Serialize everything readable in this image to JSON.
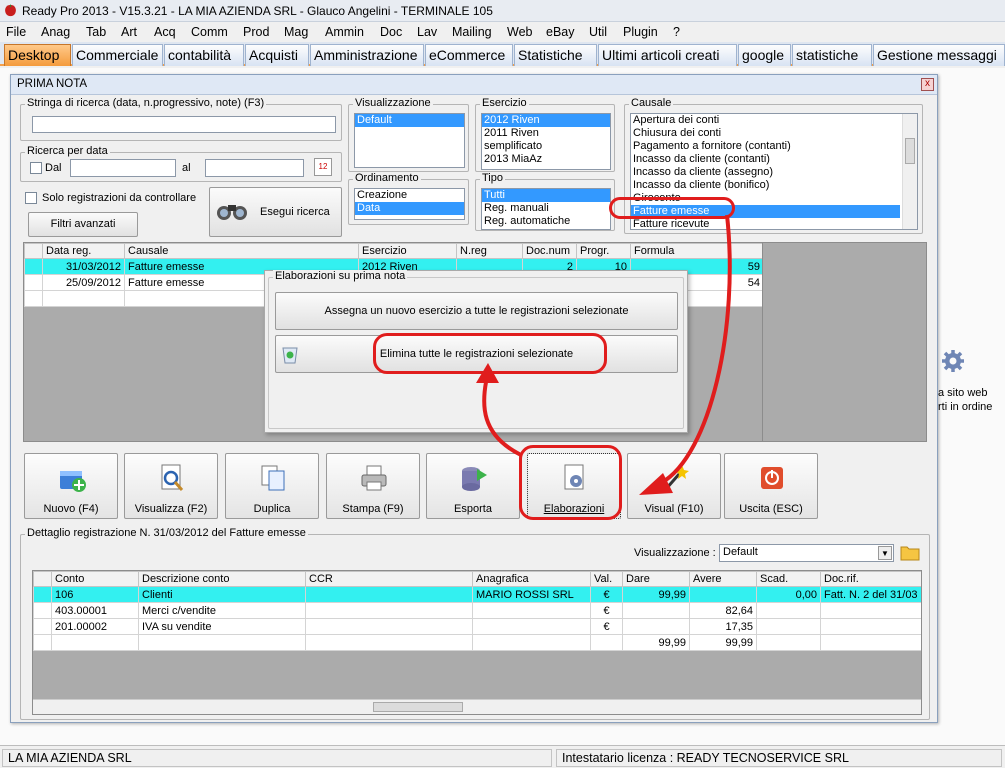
{
  "app": {
    "title": "Ready Pro 2013 - V15.3.21 - LA MIA AZIENDA SRL - Glauco Angelini - TERMINALE 105"
  },
  "menu": [
    "File",
    "Anag",
    "Tab",
    "Art",
    "Acq",
    "Comm",
    "Prod",
    "Mag",
    "Ammin",
    "Doc",
    "Lav",
    "Mailing",
    "Web",
    "eBay",
    "Util",
    "Plugin",
    "?"
  ],
  "tabs": [
    "Desktop",
    "Commerciale",
    "contabilità",
    "Acquisti",
    "Amministrazione",
    "eCommerce",
    "Statistiche",
    "Ultimi articoli creati",
    "google",
    "statistiche",
    "Gestione messaggi"
  ],
  "desktop_shortcut": {
    "line1": "a sito web",
    "line2": "rti in ordine"
  },
  "window": {
    "title": "PRIMA NOTA",
    "close": "x"
  },
  "search": {
    "label": "Stringa di ricerca (data, n.progressivo, note) (F3)",
    "value": ""
  },
  "date_search": {
    "label": "Ricerca per data",
    "dal_label": "Dal",
    "al_label": "al",
    "dal_value": "",
    "al_value": "",
    "cal_icon": "12"
  },
  "only_control": "Solo registrazioni da controllare",
  "filter_button": "Filtri avanzati",
  "search_button": "Esegui ricerca",
  "visualizzazione": {
    "label": "Visualizzazione",
    "items": [
      "Default"
    ],
    "selected": "Default"
  },
  "ordinamento": {
    "label": "Ordinamento",
    "items": [
      "Creazione",
      "Data"
    ],
    "selected": "Data"
  },
  "esercizio": {
    "label": "Esercizio",
    "items": [
      "2012 Riven",
      "2011 Riven",
      "semplificato",
      "2013 MiaAz"
    ],
    "selected": "2012 Riven"
  },
  "tipo": {
    "label": "Tipo",
    "items": [
      "Tutti",
      "Reg. manuali",
      "Reg. automatiche"
    ],
    "selected": "Tutti"
  },
  "causale": {
    "label": "Causale",
    "items": [
      "Apertura dei conti",
      "Chiusura dei conti",
      "Pagamento a fornitore (contanti)",
      "Incasso da cliente (contanti)",
      "Incasso da cliente (assegno)",
      "Incasso da cliente (bonifico)",
      "Giroconto",
      "Fatture emesse",
      "Fatture ricevute"
    ],
    "selected": "Fatture emesse"
  },
  "reg_grid": {
    "columns": [
      "Data reg.",
      "Causale",
      "Esercizio",
      "N.reg",
      "Doc.num",
      "Progr.",
      "Formula"
    ],
    "rows": [
      {
        "date": "31/03/2012",
        "causale": "Fatture emesse",
        "esercizio": "2012 Riven",
        "nreg": "",
        "docnum": "2",
        "progr": "10",
        "formula": "59"
      },
      {
        "date": "25/09/2012",
        "causale": "Fatture emesse",
        "esercizio": "",
        "nreg": "",
        "docnum": "",
        "progr": "",
        "formula": "54"
      }
    ]
  },
  "popup": {
    "title": "Elaborazioni su prima nota",
    "btn1": "Assegna un nuovo esercizio a tutte le registrazioni selezionate",
    "btn2": "Elimina tutte le registrazioni selezionate"
  },
  "toolbar": [
    "Nuovo (F4)",
    "Visualizza (F2)",
    "Duplica",
    "Stampa (F9)",
    "Esporta",
    "Elaborazioni",
    "Visual (F10)",
    "Uscita (ESC)"
  ],
  "detail": {
    "label": "Dettaglio registrazione N. 31/03/2012 del Fatture emesse",
    "view_label": "Visualizzazione :",
    "view_value": "Default"
  },
  "detail_grid": {
    "columns": [
      "Conto",
      "Descrizione conto",
      "CCR",
      "Anagrafica",
      "Val.",
      "Dare",
      "Avere",
      "Scad.",
      "Doc.rif."
    ],
    "rows": [
      {
        "conto": "106",
        "desc": "Clienti",
        "ccr": "",
        "anag": "MARIO ROSSI SRL",
        "val": "€",
        "dare": "99,99",
        "avere": "",
        "scad": "0,00",
        "docrif": "Fatt. N. 2 del 31/03"
      },
      {
        "conto": "403.00001",
        "desc": "Merci c/vendite",
        "ccr": "",
        "anag": "",
        "val": "€",
        "dare": "",
        "avere": "82,64",
        "scad": "",
        "docrif": ""
      },
      {
        "conto": "201.00002",
        "desc": "IVA su vendite",
        "ccr": "",
        "anag": "",
        "val": "€",
        "dare": "",
        "avere": "17,35",
        "scad": "",
        "docrif": ""
      },
      {
        "conto": "",
        "desc": "",
        "ccr": "",
        "anag": "",
        "val": "",
        "dare": "99,99",
        "avere": "99,99",
        "scad": "",
        "docrif": ""
      }
    ]
  },
  "status": {
    "company": "LA MIA AZIENDA SRL",
    "license": "Intestatario licenza : READY TECNOSERVICE SRL"
  },
  "colors": {
    "accent_tab": "#f49b3c",
    "selection": "#3399ff",
    "row_highlight": "#33f0f0",
    "annotation": "#e01d1d"
  }
}
